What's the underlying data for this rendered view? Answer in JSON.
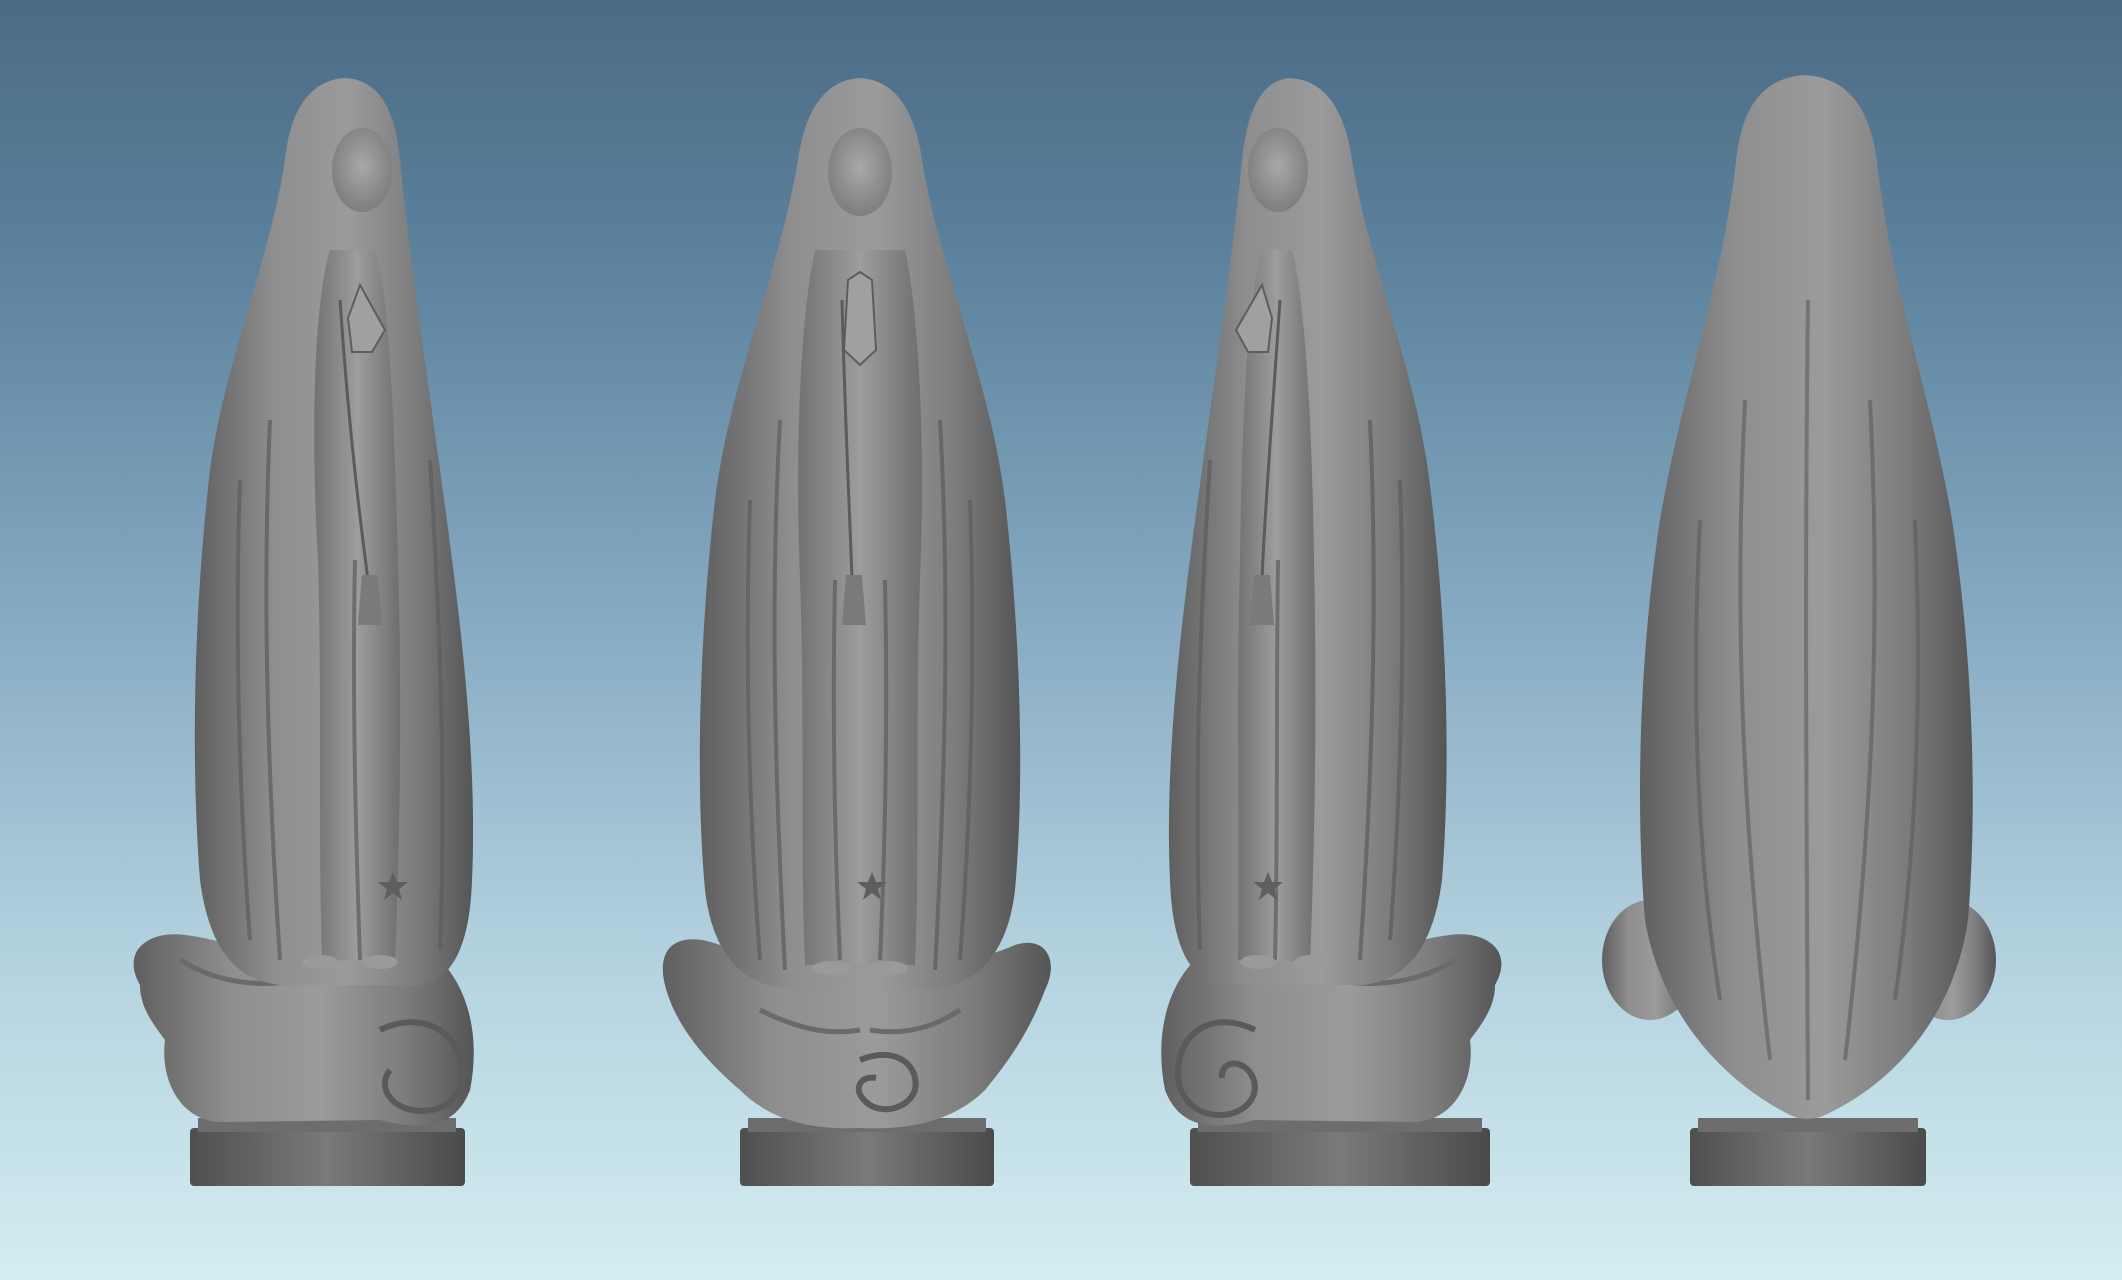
{
  "scene": {
    "description_free": true,
    "background": {
      "top_color": "#4b6b84",
      "mid_color": "#86aac2",
      "bottom_color": "#d3edf0"
    },
    "statue_color": "#8c8c8c",
    "views": [
      {
        "view": "three-quarter-left"
      },
      {
        "view": "front"
      },
      {
        "view": "three-quarter-right"
      },
      {
        "view": "back"
      }
    ]
  }
}
